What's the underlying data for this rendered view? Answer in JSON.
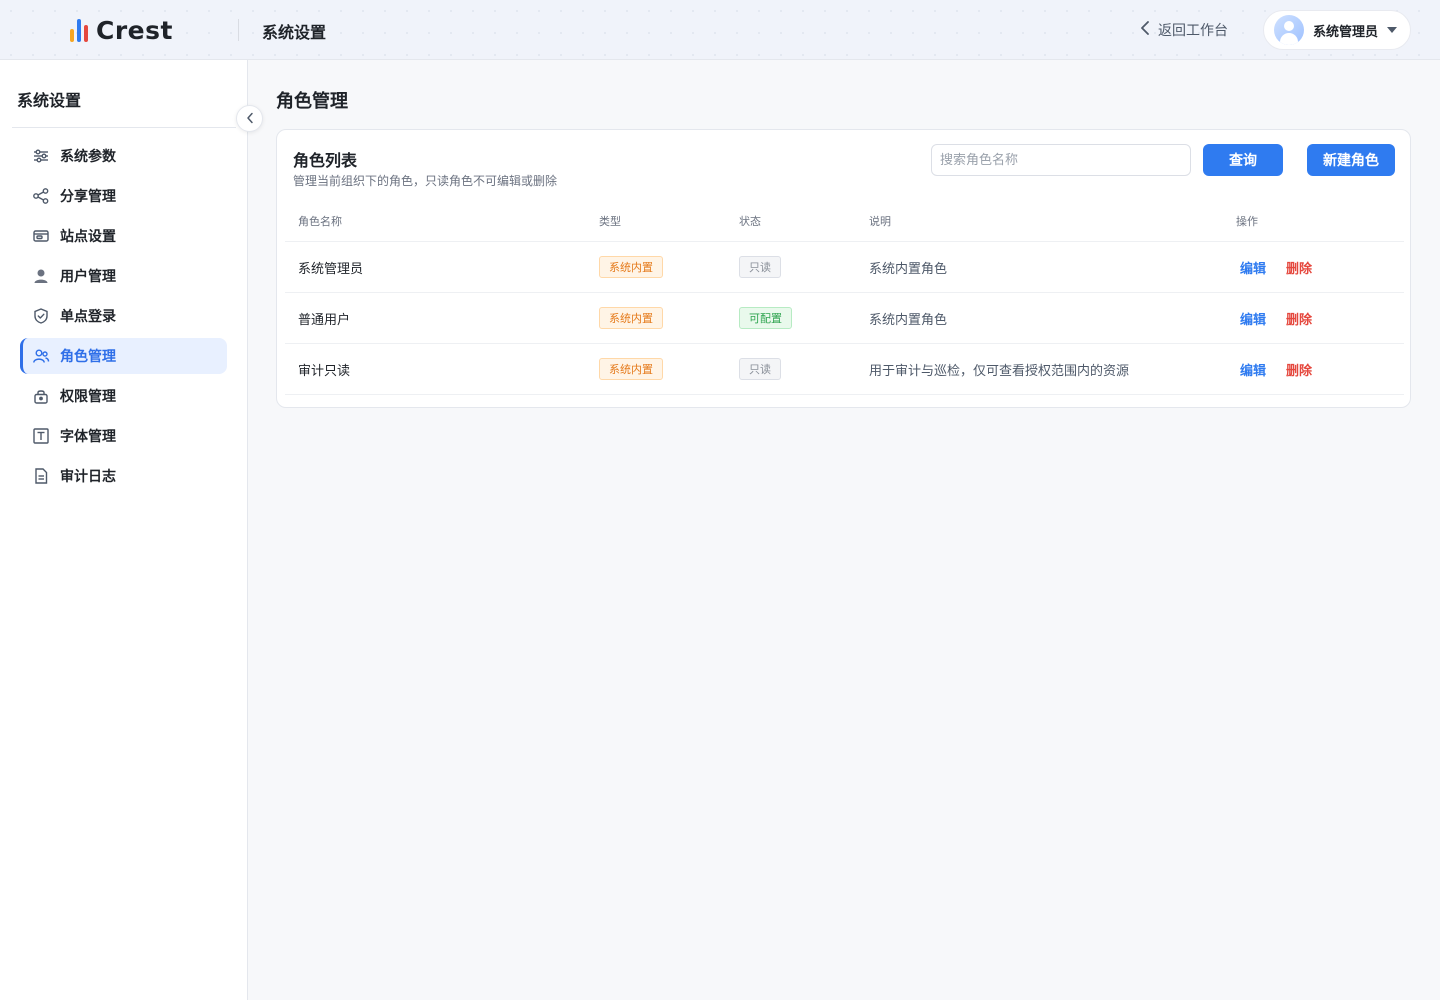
{
  "header": {
    "brand": "Crest",
    "section_title": "系统设置",
    "back_label": "返回工作台",
    "user_name": "系统管理员"
  },
  "sidebar": {
    "title": "系统设置",
    "items": [
      {
        "label": "系统参数",
        "icon": "sliders-icon",
        "active": false
      },
      {
        "label": "分享管理",
        "icon": "share-icon",
        "active": false
      },
      {
        "label": "站点设置",
        "icon": "site-icon",
        "active": false
      },
      {
        "label": "用户管理",
        "icon": "user-icon",
        "active": false
      },
      {
        "label": "单点登录",
        "icon": "shield-icon",
        "active": false
      },
      {
        "label": "角色管理",
        "icon": "users-icon",
        "active": true
      },
      {
        "label": "权限管理",
        "icon": "lock-icon",
        "active": false
      },
      {
        "label": "字体管理",
        "icon": "font-icon",
        "active": false
      },
      {
        "label": "审计日志",
        "icon": "document-icon",
        "active": false
      }
    ]
  },
  "main": {
    "page_title": "角色管理",
    "card": {
      "title": "角色列表",
      "subtitle": "管理当前组织下的角色，只读角色不可编辑或删除",
      "search_placeholder": "搜索角色名称",
      "query_label": "查询",
      "new_label": "新建角色"
    },
    "table": {
      "columns": [
        "角色名称",
        "类型",
        "状态",
        "说明",
        "操作"
      ],
      "rows": [
        {
          "name": "系统管理员",
          "type": "系统内置",
          "status": "只读",
          "status_kind": "readonly",
          "desc": "系统内置角色",
          "edit": "编辑",
          "delete": "删除"
        },
        {
          "name": "普通用户",
          "type": "系统内置",
          "status": "可配置",
          "status_kind": "config",
          "desc": "系统内置角色",
          "edit": "编辑",
          "delete": "删除"
        },
        {
          "name": "审计只读",
          "type": "系统内置",
          "status": "只读",
          "status_kind": "readonly",
          "desc": "用于审计与巡检，仅可查看授权范围内的资源",
          "edit": "编辑",
          "delete": "删除"
        }
      ]
    }
  },
  "colors": {
    "accent": "#2f7bf0",
    "danger": "#e5483e",
    "logo_bars": [
      "#f5a623",
      "#2f7bf0",
      "#e5483e"
    ]
  }
}
